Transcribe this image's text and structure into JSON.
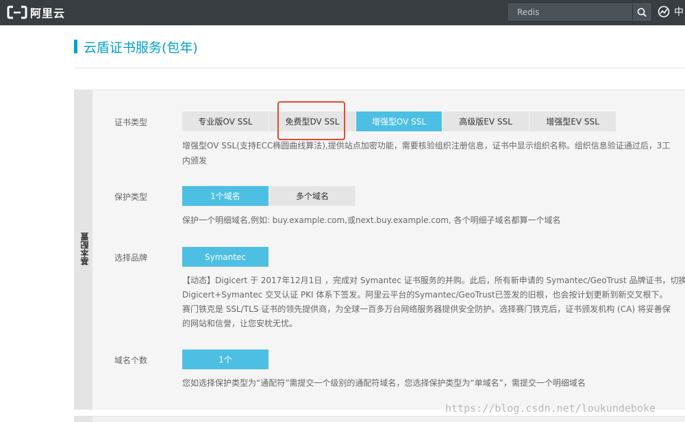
{
  "header": {
    "logo_text": "阿里云",
    "search": {
      "value": "Redis"
    },
    "right_text": "中"
  },
  "page": {
    "title": "云盾证书服务(包年)"
  },
  "config": {
    "section_label": "基本配置",
    "cert_type": {
      "label": "证书类型",
      "options": [
        "专业版OV SSL",
        "免费型DV SSL",
        "增强型OV SSL",
        "高级版EV SSL",
        "增强型EV SSL"
      ],
      "selected": "增强型OV SSL",
      "description": [
        "增强型OV SSL(支持ECC椭圆曲线算法),提供站点加密功能，需要核验组织注册信息，证书中显示组织名称。组织信息验证通过后，3工",
        "内颁发"
      ]
    },
    "protect_type": {
      "label": "保护类型",
      "options": [
        "1个域名",
        "多个域名"
      ],
      "selected": "1个域名",
      "description": "保护一个明细域名,例如: buy.example.com,或next.buy.example.com, 各个明细子域名都算一个域名"
    },
    "brand": {
      "label": "选择品牌",
      "options": [
        "Symantec"
      ],
      "selected": "Symantec",
      "description": [
        "【动态】Digicert 于 2017年12月1日 ，完成对 Symantec 证书服务的并购。此后，所有新申请的 Symantec/GeoTrust 品牌证书，切换到",
        "Digicert+Symantec 交叉认证 PKI 体系下签发。阿里云平台的Symantec/GeoTrust已签发的旧根，也会按计划更新到新交叉根下。",
        "赛门铁克是 SSL/TLS 证书的领先提供商，为全球一百多万台网络服务器提供安全防护。选择赛门铁克后，证书颁发机构 (CA) 将妥善保",
        "的网站和信誉，让您安枕无忧。"
      ]
    },
    "domain_count": {
      "label": "域名个数",
      "options": [
        "1个"
      ],
      "selected": "1个",
      "description": "您如选择保护类型为“通配符”需提交一个级别的通配符域名，您选择保护类型为“单域名”，需提交一个明细域名"
    }
  },
  "watermark": "https://blog.csdn.net/loukundeboke",
  "colors": {
    "accent": "#00a2ca",
    "selected": "#4dbfe3",
    "highlight": "#e8462d",
    "topbar": "#373d41"
  }
}
